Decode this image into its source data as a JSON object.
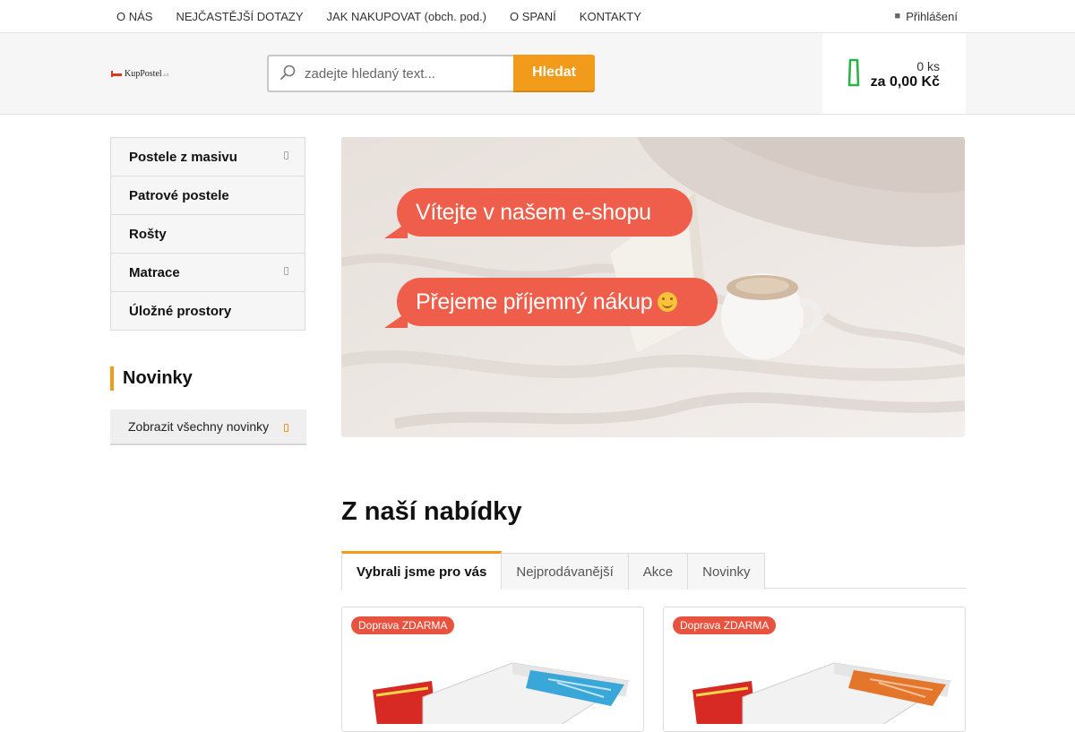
{
  "topnav": {
    "items": [
      "O NÁS",
      "NEJČASTĚJŠÍ DOTAZY",
      "JAK NAKUPOVAT (obch. pod.)",
      "O SPANÍ",
      "KONTAKTY"
    ],
    "login_label": "Přihlášení",
    "login_icon": "user-icon"
  },
  "header": {
    "logo_text": "KupPostel",
    "logo_suffix": ".cz",
    "search_placeholder": "zadejte hledaný text...",
    "search_button": "Hledat",
    "search_icon": "search-icon",
    "cart_icon": "cart-icon",
    "cart_qty": "0 ks",
    "cart_total": "za 0,00 Kč"
  },
  "sidebar": {
    "categories": [
      {
        "label": "Postele z masivu",
        "has_submenu": true
      },
      {
        "label": "Patrové postele",
        "has_submenu": false
      },
      {
        "label": "Rošty",
        "has_submenu": false
      },
      {
        "label": "Matrace",
        "has_submenu": true
      },
      {
        "label": "Úložné prostory",
        "has_submenu": false
      }
    ],
    "news_title": "Novinky",
    "news_button": "Zobrazit všechny novinky"
  },
  "banner": {
    "line1": "Vítejte v našem e-shopu",
    "line2": "Přejeme příjemný nákup"
  },
  "offer": {
    "title": "Z naší nabídky",
    "tabs": [
      "Vybrali jsme pro vás",
      "Nejprodávanější",
      "Akce",
      "Novinky"
    ],
    "active_tab": 0,
    "products": [
      {
        "badge": "Doprava ZDARMA",
        "stripe_color": "#3aa7d9"
      },
      {
        "badge": "Doprava ZDARMA",
        "stripe_color": "#e4762c"
      }
    ]
  },
  "colors": {
    "accent": "#f29a1a",
    "cart_green": "#2fb14a",
    "banner_bubble": "#ee5e4a",
    "badge": "#e8533f"
  }
}
